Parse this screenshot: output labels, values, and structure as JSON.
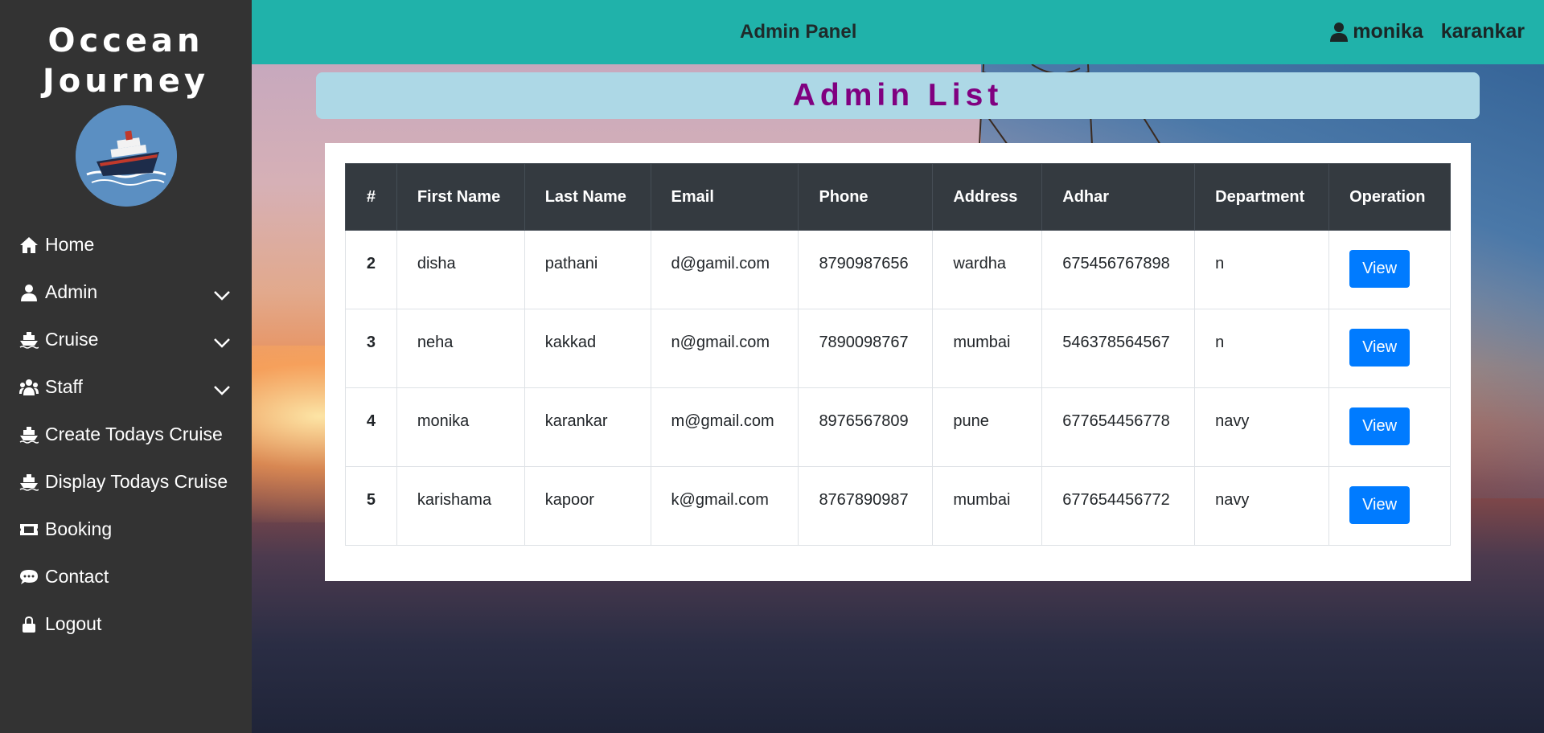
{
  "sidebar": {
    "brand_line1": "Occean",
    "brand_line2": "Journey",
    "items": [
      {
        "label": "Home",
        "icon": "home-icon"
      },
      {
        "label": "Admin",
        "icon": "user-icon"
      },
      {
        "label": "Cruise",
        "icon": "ship-icon"
      },
      {
        "label": "Staff",
        "icon": "users-icon"
      },
      {
        "label": "Create Todays Cruise",
        "icon": "ship-icon"
      },
      {
        "label": "Display Todays Cruise",
        "icon": "ship-icon"
      },
      {
        "label": "Booking",
        "icon": "ticket-icon"
      },
      {
        "label": "Contact",
        "icon": "chat-icon"
      },
      {
        "label": "Logout",
        "icon": "lock-icon"
      }
    ]
  },
  "header": {
    "title": "Admin Panel",
    "user_first": "monika",
    "user_last": "karankar"
  },
  "page": {
    "heading": "Admin List"
  },
  "table": {
    "columns": [
      "#",
      "First Name",
      "Last Name",
      "Email",
      "Phone",
      "Address",
      "Adhar",
      "Department",
      "Operation"
    ],
    "rows": [
      {
        "id": "2",
        "first": "disha",
        "last": "pathani",
        "email": "d@gamil.com",
        "phone": "8790987656",
        "address": "wardha",
        "adhar": "675456767898",
        "department": "n",
        "action": "View"
      },
      {
        "id": "3",
        "first": "neha",
        "last": "kakkad",
        "email": "n@gmail.com",
        "phone": "7890098767",
        "address": "mumbai",
        "adhar": "546378564567",
        "department": "n",
        "action": "View"
      },
      {
        "id": "4",
        "first": "monika",
        "last": "karankar",
        "email": "m@gmail.com",
        "phone": "8976567809",
        "address": "pune",
        "adhar": "677654456778",
        "department": "navy",
        "action": "View"
      },
      {
        "id": "5",
        "first": "karishama",
        "last": "kapoor",
        "email": "k@gmail.com",
        "phone": "8767890987",
        "address": "mumbai",
        "adhar": "677654456772",
        "department": "navy",
        "action": "View"
      }
    ]
  },
  "colors": {
    "sidebar_bg": "#333333",
    "topbar_bg": "#20b2aa",
    "banner_bg": "#add8e6",
    "heading_text": "#800080",
    "table_header_bg": "#343a40",
    "button_bg": "#007bff"
  }
}
